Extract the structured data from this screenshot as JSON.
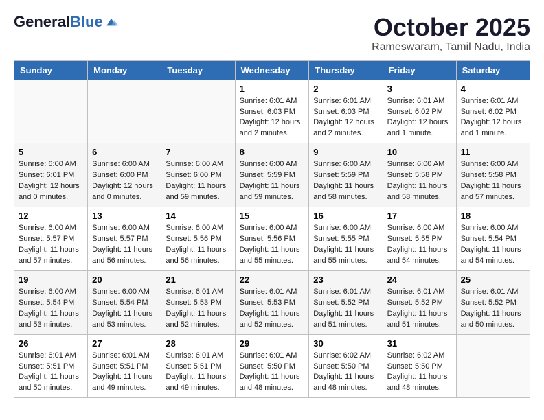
{
  "logo": {
    "line1": "General",
    "line2": "Blue"
  },
  "title": "October 2025",
  "subtitle": "Rameswaram, Tamil Nadu, India",
  "days_header": [
    "Sunday",
    "Monday",
    "Tuesday",
    "Wednesday",
    "Thursday",
    "Friday",
    "Saturday"
  ],
  "weeks": [
    [
      {
        "day": "",
        "info": ""
      },
      {
        "day": "",
        "info": ""
      },
      {
        "day": "",
        "info": ""
      },
      {
        "day": "1",
        "info": "Sunrise: 6:01 AM\nSunset: 6:03 PM\nDaylight: 12 hours and 2 minutes."
      },
      {
        "day": "2",
        "info": "Sunrise: 6:01 AM\nSunset: 6:03 PM\nDaylight: 12 hours and 2 minutes."
      },
      {
        "day": "3",
        "info": "Sunrise: 6:01 AM\nSunset: 6:02 PM\nDaylight: 12 hours and 1 minute."
      },
      {
        "day": "4",
        "info": "Sunrise: 6:01 AM\nSunset: 6:02 PM\nDaylight: 12 hours and 1 minute."
      }
    ],
    [
      {
        "day": "5",
        "info": "Sunrise: 6:00 AM\nSunset: 6:01 PM\nDaylight: 12 hours and 0 minutes."
      },
      {
        "day": "6",
        "info": "Sunrise: 6:00 AM\nSunset: 6:00 PM\nDaylight: 12 hours and 0 minutes."
      },
      {
        "day": "7",
        "info": "Sunrise: 6:00 AM\nSunset: 6:00 PM\nDaylight: 11 hours and 59 minutes."
      },
      {
        "day": "8",
        "info": "Sunrise: 6:00 AM\nSunset: 5:59 PM\nDaylight: 11 hours and 59 minutes."
      },
      {
        "day": "9",
        "info": "Sunrise: 6:00 AM\nSunset: 5:59 PM\nDaylight: 11 hours and 58 minutes."
      },
      {
        "day": "10",
        "info": "Sunrise: 6:00 AM\nSunset: 5:58 PM\nDaylight: 11 hours and 58 minutes."
      },
      {
        "day": "11",
        "info": "Sunrise: 6:00 AM\nSunset: 5:58 PM\nDaylight: 11 hours and 57 minutes."
      }
    ],
    [
      {
        "day": "12",
        "info": "Sunrise: 6:00 AM\nSunset: 5:57 PM\nDaylight: 11 hours and 57 minutes."
      },
      {
        "day": "13",
        "info": "Sunrise: 6:00 AM\nSunset: 5:57 PM\nDaylight: 11 hours and 56 minutes."
      },
      {
        "day": "14",
        "info": "Sunrise: 6:00 AM\nSunset: 5:56 PM\nDaylight: 11 hours and 56 minutes."
      },
      {
        "day": "15",
        "info": "Sunrise: 6:00 AM\nSunset: 5:56 PM\nDaylight: 11 hours and 55 minutes."
      },
      {
        "day": "16",
        "info": "Sunrise: 6:00 AM\nSunset: 5:55 PM\nDaylight: 11 hours and 55 minutes."
      },
      {
        "day": "17",
        "info": "Sunrise: 6:00 AM\nSunset: 5:55 PM\nDaylight: 11 hours and 54 minutes."
      },
      {
        "day": "18",
        "info": "Sunrise: 6:00 AM\nSunset: 5:54 PM\nDaylight: 11 hours and 54 minutes."
      }
    ],
    [
      {
        "day": "19",
        "info": "Sunrise: 6:00 AM\nSunset: 5:54 PM\nDaylight: 11 hours and 53 minutes."
      },
      {
        "day": "20",
        "info": "Sunrise: 6:00 AM\nSunset: 5:54 PM\nDaylight: 11 hours and 53 minutes."
      },
      {
        "day": "21",
        "info": "Sunrise: 6:01 AM\nSunset: 5:53 PM\nDaylight: 11 hours and 52 minutes."
      },
      {
        "day": "22",
        "info": "Sunrise: 6:01 AM\nSunset: 5:53 PM\nDaylight: 11 hours and 52 minutes."
      },
      {
        "day": "23",
        "info": "Sunrise: 6:01 AM\nSunset: 5:52 PM\nDaylight: 11 hours and 51 minutes."
      },
      {
        "day": "24",
        "info": "Sunrise: 6:01 AM\nSunset: 5:52 PM\nDaylight: 11 hours and 51 minutes."
      },
      {
        "day": "25",
        "info": "Sunrise: 6:01 AM\nSunset: 5:52 PM\nDaylight: 11 hours and 50 minutes."
      }
    ],
    [
      {
        "day": "26",
        "info": "Sunrise: 6:01 AM\nSunset: 5:51 PM\nDaylight: 11 hours and 50 minutes."
      },
      {
        "day": "27",
        "info": "Sunrise: 6:01 AM\nSunset: 5:51 PM\nDaylight: 11 hours and 49 minutes."
      },
      {
        "day": "28",
        "info": "Sunrise: 6:01 AM\nSunset: 5:51 PM\nDaylight: 11 hours and 49 minutes."
      },
      {
        "day": "29",
        "info": "Sunrise: 6:01 AM\nSunset: 5:50 PM\nDaylight: 11 hours and 48 minutes."
      },
      {
        "day": "30",
        "info": "Sunrise: 6:02 AM\nSunset: 5:50 PM\nDaylight: 11 hours and 48 minutes."
      },
      {
        "day": "31",
        "info": "Sunrise: 6:02 AM\nSunset: 5:50 PM\nDaylight: 11 hours and 48 minutes."
      },
      {
        "day": "",
        "info": ""
      }
    ]
  ]
}
